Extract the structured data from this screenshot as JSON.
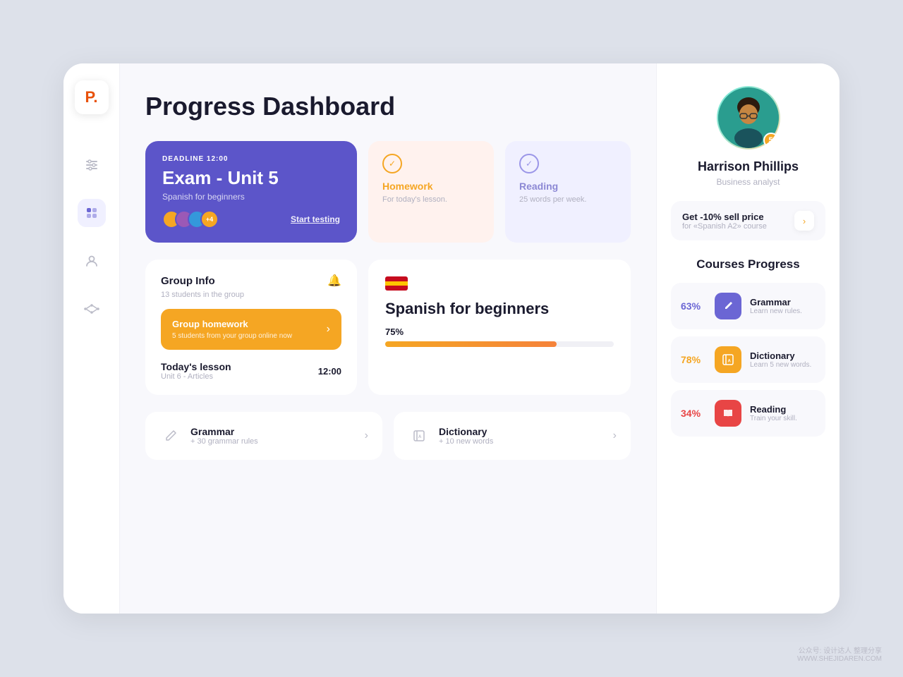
{
  "app": {
    "logo": "P.",
    "title": "Progress Dashboard"
  },
  "sidebar": {
    "items": [
      {
        "id": "sliders",
        "icon": "⊞",
        "label": "sliders",
        "active": false
      },
      {
        "id": "grid",
        "icon": "⊡",
        "label": "grid",
        "active": true
      },
      {
        "id": "person",
        "icon": "○",
        "label": "person",
        "active": false
      },
      {
        "id": "share",
        "icon": "∿",
        "label": "share",
        "active": false
      }
    ]
  },
  "exam_card": {
    "deadline_label": "DEADLINE",
    "deadline_time": "12:00",
    "title": "Exam - Unit 5",
    "subtitle": "Spanish for beginners",
    "start_label": "Start testing",
    "avatar_count": "+4"
  },
  "homework_card": {
    "title": "Homework",
    "description": "For today's lesson."
  },
  "reading_card": {
    "title": "Reading",
    "description": "25 words per week."
  },
  "group_card": {
    "title": "Group Info",
    "subtitle": "13 students in the group",
    "homework_title": "Group homework",
    "homework_sub": "5 students from your group online now",
    "lesson_title": "Today's lesson",
    "lesson_time": "12:00",
    "lesson_sub": "Unit 6 - Articles"
  },
  "spanish_card": {
    "title": "Spanish for beginners",
    "progress": 75,
    "progress_label": "75%"
  },
  "bottom_cards": [
    {
      "id": "grammar",
      "title": "Grammar",
      "subtitle": "+ 30 grammar rules"
    },
    {
      "id": "dictionary",
      "title": "Dictionary",
      "subtitle": "+ 10 new words"
    }
  ],
  "profile": {
    "name": "Harrison Phillips",
    "role": "Business analyst",
    "notification_count": "5"
  },
  "promo": {
    "title": "Get -10% sell price",
    "subtitle": "for «Spanish A2» course"
  },
  "courses": {
    "title": "Courses Progress",
    "items": [
      {
        "id": "grammar",
        "percent": "63%",
        "color": "purple",
        "name": "Grammar",
        "desc": "Learn new rules.",
        "icon": "✏"
      },
      {
        "id": "dictionary",
        "percent": "78%",
        "color": "orange",
        "name": "Dictionary",
        "desc": "Learn 5 new words.",
        "icon": "A"
      },
      {
        "id": "reading",
        "percent": "34%",
        "color": "red",
        "name": "Reading",
        "desc": "Train your skill.",
        "icon": "📖"
      }
    ]
  },
  "watermark": {
    "line1": "公众号: 设计达人 整理分享",
    "line2": "WWW.SHEJIDAREN.COM"
  }
}
